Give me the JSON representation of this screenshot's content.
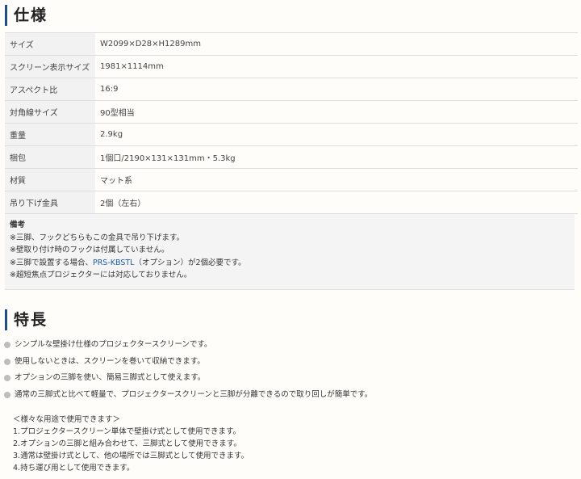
{
  "spec_heading": "仕様",
  "specs": [
    {
      "label": "サイズ",
      "value": "W2099×D28×H1289mm"
    },
    {
      "label": "スクリーン表示サイズ",
      "value": "1981×1114mm"
    },
    {
      "label": "アスペクト比",
      "value": "16:9"
    },
    {
      "label": "対角線サイズ",
      "value": "90型相当"
    },
    {
      "label": "重量",
      "value": "2.9kg"
    },
    {
      "label": "梱包",
      "value": "1個口/2190×131×131mm・5.3kg"
    },
    {
      "label": "材質",
      "value": "マット系"
    },
    {
      "label": "吊り下げ金具",
      "value": "2個（左右）"
    }
  ],
  "notes": {
    "title": "備考",
    "line1": "※三脚、フックどちらもこの金具で吊り下げます。",
    "line2": "※壁取り付け時のフックは付属していません。",
    "line3_prefix": "※三脚で設置する場合、",
    "line3_link": "PRS-KBSTL",
    "line3_suffix": "（オプション）が2個必要です。",
    "line4": "※超短焦点プロジェクターには対応しておりません。"
  },
  "features_heading": "特長",
  "features": [
    "シンプルな壁掛け仕様のプロジェクタースクリーンです。",
    "使用しないときは、スクリーンを巻いて収納できます。",
    "オプションの三脚を使い、簡易三脚式として使えます。",
    "通常の三脚式と比べて軽量で、プロジェクタースクリーンと三脚が分離できるので取り回しが簡単です。"
  ],
  "usage": {
    "title": "＜様々な用途で使用できます＞",
    "items": [
      "1.プロジェクタースクリーン単体で壁掛け式として使用できます。",
      "2.オプションの三脚と組み合わせて、三脚式として使用できます。",
      "3.通常は壁掛け式として、他の場所では三脚式として使用できます。",
      "4.持ち運び用として使用できます。"
    ]
  }
}
